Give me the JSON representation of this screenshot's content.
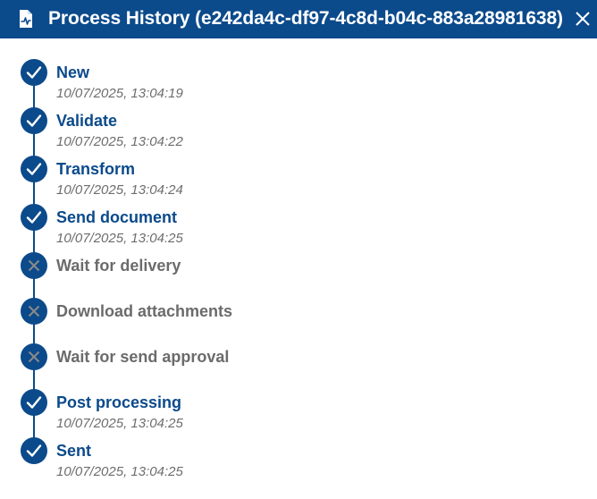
{
  "window": {
    "title": "Process History (e242da4c-df97-4c8d-b04c-883a28981638)",
    "icon": "process-file-icon",
    "close_icon": "close-icon"
  },
  "colors": {
    "header_bg": "#0b4a8b",
    "done": "#0b4a8b",
    "pending_text": "#6b6b6b",
    "timestamp": "#6d6d6d"
  },
  "steps": [
    {
      "label": "New",
      "status": "done",
      "timestamp": "10/07/2025, 13:04:19"
    },
    {
      "label": "Validate",
      "status": "done",
      "timestamp": "10/07/2025, 13:04:22"
    },
    {
      "label": "Transform",
      "status": "done",
      "timestamp": "10/07/2025, 13:04:24"
    },
    {
      "label": "Send document",
      "status": "done",
      "timestamp": "10/07/2025, 13:04:25"
    },
    {
      "label": "Wait for delivery",
      "status": "skipped",
      "timestamp": ""
    },
    {
      "label": "Download attachments",
      "status": "skipped",
      "timestamp": ""
    },
    {
      "label": "Wait for send approval",
      "status": "skipped",
      "timestamp": ""
    },
    {
      "label": "Post processing",
      "status": "done",
      "timestamp": "10/07/2025, 13:04:25"
    },
    {
      "label": "Sent",
      "status": "done",
      "timestamp": "10/07/2025, 13:04:25"
    }
  ]
}
